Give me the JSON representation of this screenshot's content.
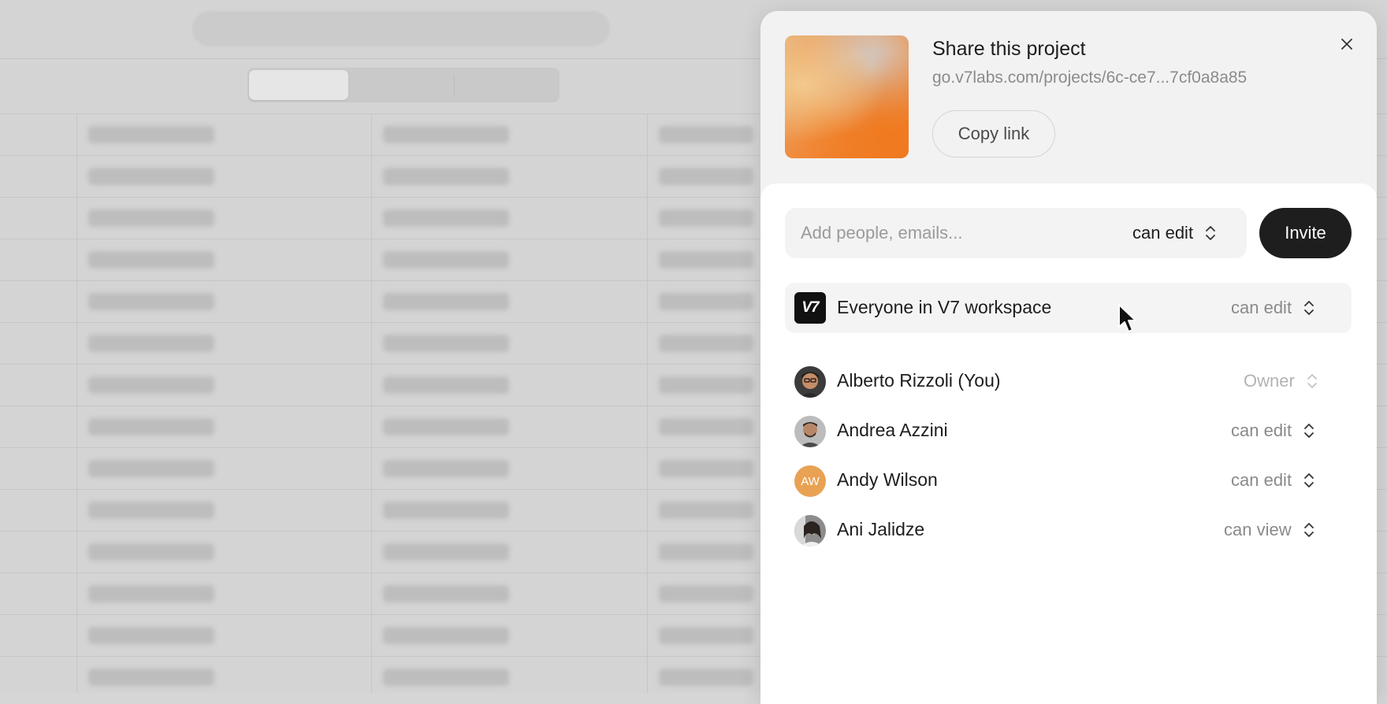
{
  "modal": {
    "title": "Share this project",
    "url": "go.v7labs.com/projects/6c-ce7...7cf0a8a85",
    "copy_label": "Copy link",
    "close_icon": "close-icon"
  },
  "invite": {
    "placeholder": "Add people, emails...",
    "permission": "can edit",
    "button_label": "Invite"
  },
  "workspace": {
    "logo_text": "V7",
    "label": "Everyone in V7 workspace",
    "permission": "can edit"
  },
  "members": [
    {
      "name": "Alberto Rizzoli (You)",
      "permission": "Owner",
      "avatar": "photo"
    },
    {
      "name": "Andrea Azzini",
      "permission": "can edit",
      "avatar": "photo"
    },
    {
      "name": "Andy Wilson",
      "permission": "can edit",
      "avatar": "initials",
      "initials": "AW",
      "avatar_color": "#e9a253"
    },
    {
      "name": "Ani Jalidze",
      "permission": "can view",
      "avatar": "photo"
    }
  ],
  "colors": {
    "invite_button": "#1e1e1e",
    "accent_orange": "#f07a1f"
  }
}
